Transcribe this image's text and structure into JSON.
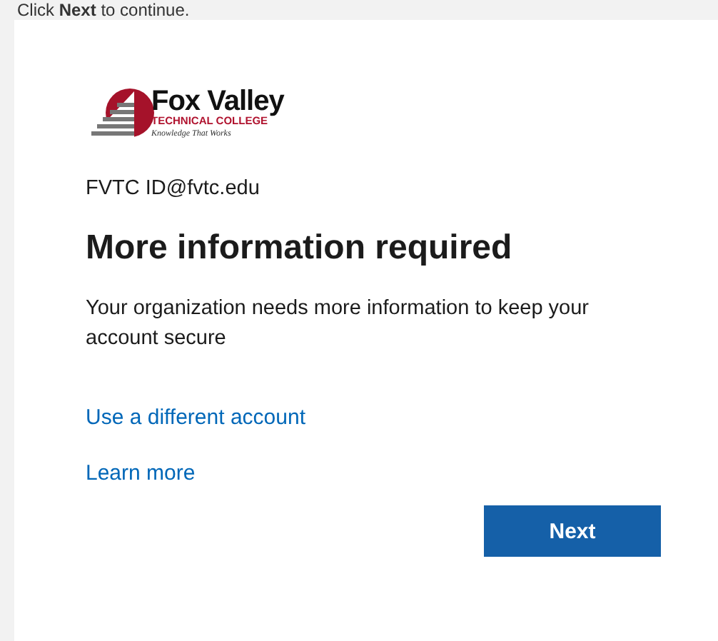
{
  "caption": "Click **Next** to continue.",
  "logo": {
    "name": "Fox Valley",
    "subtitle": "TECHNICAL COLLEGE",
    "tagline": "Knowledge That Works"
  },
  "account": "FVTC ID@fvtc.edu",
  "title": "More information required",
  "message": "Your organization needs more information to keep your account secure",
  "links": [
    "Use a different account",
    "Learn more"
  ],
  "button": "Next"
}
